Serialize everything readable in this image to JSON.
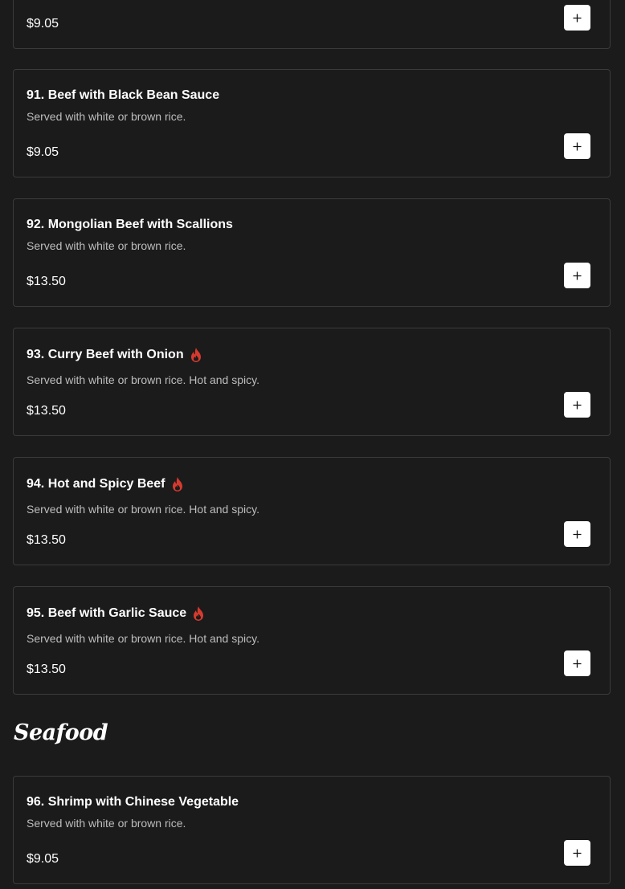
{
  "section": {
    "title": "Seafood"
  },
  "colors": {
    "background": "#1b1b1b",
    "card_border": "#3b3b3b",
    "spicy_icon": "#d63a2f",
    "add_button": "#ffffff"
  },
  "items": [
    {
      "name": "",
      "description": "",
      "price": "$9.05",
      "spicy": false
    },
    {
      "name": "91. Beef with Black Bean Sauce",
      "description": "Served with white or brown rice.",
      "price": "$9.05",
      "spicy": false
    },
    {
      "name": "92. Mongolian Beef with Scallions",
      "description": "Served with white or brown rice.",
      "price": "$13.50",
      "spicy": false
    },
    {
      "name": "93. Curry Beef with Onion",
      "description": "Served with white or brown rice. Hot and spicy.",
      "price": "$13.50",
      "spicy": true
    },
    {
      "name": "94. Hot and Spicy Beef",
      "description": "Served with white or brown rice. Hot and spicy.",
      "price": "$13.50",
      "spicy": true
    },
    {
      "name": "95. Beef with Garlic Sauce",
      "description": "Served with white or brown rice. Hot and spicy.",
      "price": "$13.50",
      "spicy": true
    },
    {
      "name": "96. Shrimp with Chinese Vegetable",
      "description": "Served with white or brown rice.",
      "price": "$9.05",
      "spicy": false
    }
  ],
  "icons": {
    "spicy": "flame-icon",
    "add": "plus-icon"
  }
}
